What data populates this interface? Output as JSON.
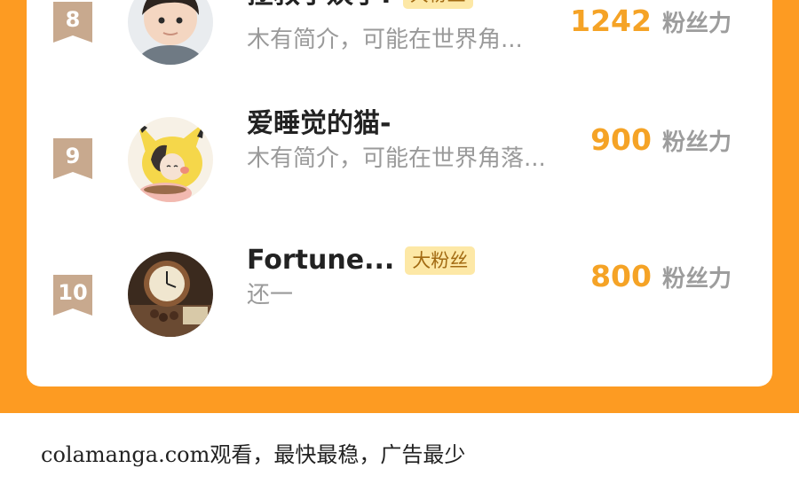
{
  "colors": {
    "accent_orange": "#fd9b22",
    "score_orange": "#f5a326",
    "badge_bg": "#fde8a6",
    "badge_text": "#a26a12",
    "rank_badge": "#c8a98e"
  },
  "rank_list": [
    {
      "rank": "8",
      "name": "拯救小姨子!",
      "badge": "大粉丝",
      "intro": "木有简介，可能在世界角...",
      "score": "1242",
      "score_unit": "粉丝力",
      "avatar_icon": "child-photo-avatar"
    },
    {
      "rank": "9",
      "name": "爱睡觉的猫-",
      "badge": "",
      "intro": "木有简介，可能在世界角落...",
      "score": "900",
      "score_unit": "粉丝力",
      "avatar_icon": "pikachu-costume-avatar"
    },
    {
      "rank": "10",
      "name": "Fortune...",
      "badge": "大粉丝",
      "intro": "还一",
      "score": "800",
      "score_unit": "粉丝力",
      "avatar_icon": "clock-photo-avatar"
    }
  ],
  "footer": {
    "text": "colamanga.com观看，最快最稳，广告最少"
  }
}
